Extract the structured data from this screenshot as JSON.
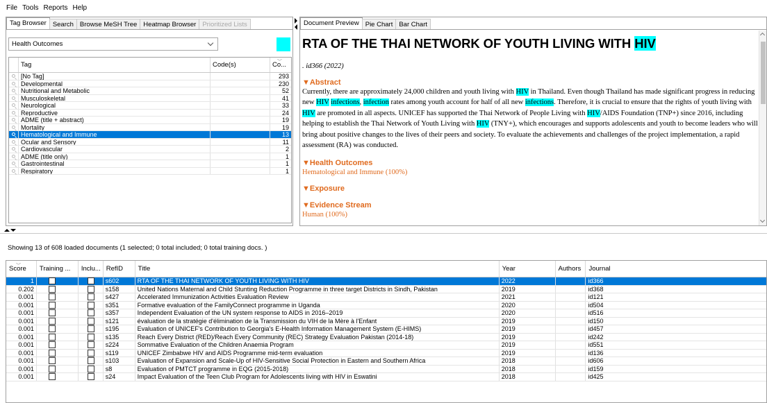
{
  "menu": [
    "File",
    "Tools",
    "Reports",
    "Help"
  ],
  "left_tabs": [
    {
      "label": "Tag Browser",
      "state": "active"
    },
    {
      "label": "Search",
      "state": "normal"
    },
    {
      "label": "Browse MeSH Tree",
      "state": "normal"
    },
    {
      "label": "Heatmap Browser",
      "state": "normal"
    },
    {
      "label": "Prioritized Lists",
      "state": "disabled"
    }
  ],
  "category_select": {
    "value": "Health Outcomes",
    "swatch_color": "#00ffff"
  },
  "tag_table": {
    "headers": [
      "Tag",
      "Code(s)",
      "Co..."
    ],
    "rows": [
      {
        "tag": "[No Tag]",
        "codes": "",
        "count": "293",
        "selected": false
      },
      {
        "tag": "Developmental",
        "codes": "",
        "count": "230",
        "selected": false
      },
      {
        "tag": "Nutritional and Metabolic",
        "codes": "",
        "count": "52",
        "selected": false
      },
      {
        "tag": "Musculoskeletal",
        "codes": "",
        "count": "41",
        "selected": false
      },
      {
        "tag": "Neurological",
        "codes": "",
        "count": "33",
        "selected": false
      },
      {
        "tag": "Reproductive",
        "codes": "",
        "count": "24",
        "selected": false
      },
      {
        "tag": "ADME (title + abstract)",
        "codes": "",
        "count": "19",
        "selected": false
      },
      {
        "tag": "Mortality",
        "codes": "",
        "count": "19",
        "selected": false
      },
      {
        "tag": "Hematological and Immune",
        "codes": "",
        "count": "13",
        "selected": true
      },
      {
        "tag": "Ocular and Sensory",
        "codes": "",
        "count": "11",
        "selected": false
      },
      {
        "tag": "Cardiovascular",
        "codes": "",
        "count": "2",
        "selected": false
      },
      {
        "tag": "ADME (title only)",
        "codes": "",
        "count": "1",
        "selected": false
      },
      {
        "tag": "Gastrointestinal",
        "codes": "",
        "count": "1",
        "selected": false
      },
      {
        "tag": "Respiratory",
        "codes": "",
        "count": "1",
        "selected": false
      }
    ]
  },
  "right_tabs": [
    {
      "label": "Document Preview",
      "state": "active"
    },
    {
      "label": "Pie Chart",
      "state": "normal"
    },
    {
      "label": "Bar Chart",
      "state": "normal"
    }
  ],
  "document": {
    "title_prefix": "RTA OF THE THAI NETWORK OF YOUTH LIVING WITH ",
    "title_highlight": "HIV",
    "meta": ". id366 (2022)",
    "abstract_heading": "▼Abstract",
    "abstract_parts": [
      {
        "text": "Currently, there are approximately 24,000 children and youth living with ",
        "hl": false
      },
      {
        "text": "HIV",
        "hl": true
      },
      {
        "text": " in Thailand. Even though Thailand has made significant progress in reducing new ",
        "hl": false
      },
      {
        "text": "HIV",
        "hl": true
      },
      {
        "text": " ",
        "hl": false
      },
      {
        "text": "infections",
        "hl": true
      },
      {
        "text": ", ",
        "hl": false
      },
      {
        "text": "infection",
        "hl": true
      },
      {
        "text": " rates among youth account for half of all new ",
        "hl": false
      },
      {
        "text": "infections",
        "hl": true
      },
      {
        "text": ". Therefore, it is crucial to ensure that the rights of youth living with ",
        "hl": false
      },
      {
        "text": "HIV",
        "hl": true
      },
      {
        "text": " are promoted in all aspects. UNICEF has supported the Thai Network of People Living with ",
        "hl": false
      },
      {
        "text": "HIV",
        "hl": true
      },
      {
        "text": "/AIDS Foundation (TNP+) since 2016, including helping to establish the Thai Network of Youth Living with ",
        "hl": false
      },
      {
        "text": "HIV",
        "hl": true
      },
      {
        "text": " (TNY+), which encourages and supports adolescents and youth to become leaders who will bring about positive changes to the lives of their peers and society. To evaluate the achievements and challenges of the project implementation, a rapid assessment (RA) was conducted.",
        "hl": false
      }
    ],
    "sections": [
      {
        "heading": "▼Health Outcomes",
        "value": "Hematological and Immune (100%)"
      },
      {
        "heading": "▼Exposure",
        "value": ""
      },
      {
        "heading": "▼Evidence Stream",
        "value": "Human (100%)"
      }
    ]
  },
  "status_line": "Showing 13 of 608 loaded documents (1 selected; 0 total included; 0 total training docs. )",
  "doc_table": {
    "headers": [
      "Score",
      "Training ...",
      "Inclu...",
      "RefID",
      "Title",
      "Year",
      "Authors",
      "Journal"
    ],
    "rows": [
      {
        "score": "1",
        "refid": "s602",
        "title": "RTA OF THE THAI NETWORK OF YOUTH LIVING WITH HIV",
        "year": "2022",
        "authors": "",
        "journal": "id366",
        "selected": true
      },
      {
        "score": "0.202",
        "refid": "s158",
        "title": "United Nations Maternal and Child Stunting Reduction Programme in three target Districts in Sindh, Pakistan",
        "year": "2019",
        "authors": "",
        "journal": "id368",
        "selected": false
      },
      {
        "score": "0.001",
        "refid": "s427",
        "title": "Accelerated Immunization Activities Evaluation Review",
        "year": "2021",
        "authors": "",
        "journal": "id121",
        "selected": false
      },
      {
        "score": "0.001",
        "refid": "s351",
        "title": "Formative evaluation of the FamilyConnect programme in Uganda",
        "year": "2020",
        "authors": "",
        "journal": "id504",
        "selected": false
      },
      {
        "score": "0.001",
        "refid": "s357",
        "title": "Independent Evaluation of the UN system response to AIDS in 2016–2019",
        "year": "2020",
        "authors": "",
        "journal": "id516",
        "selected": false
      },
      {
        "score": "0.001",
        "refid": "s121",
        "title": "évaluation de la stratégie d'élimination de la Transmission du VIH de la Mère à l'Enfant",
        "year": "2019",
        "authors": "",
        "journal": "id150",
        "selected": false
      },
      {
        "score": "0.001",
        "refid": "s195",
        "title": "Evaluation of UNICEF's Contribution to Georgia's E-Health Information Management System (E-HIMS)",
        "year": "2019",
        "authors": "",
        "journal": "id457",
        "selected": false
      },
      {
        "score": "0.001",
        "refid": "s135",
        "title": "Reach Every District (RED)/Reach Every Community (REC) Strategy Evaluation Pakistan (2014-18)",
        "year": "2019",
        "authors": "",
        "journal": "id242",
        "selected": false
      },
      {
        "score": "0.001",
        "refid": "s224",
        "title": "Sommative Evaluation of the Children Anaemia Program",
        "year": "2019",
        "authors": "",
        "journal": "id551",
        "selected": false
      },
      {
        "score": "0.001",
        "refid": "s119",
        "title": "UNICEF Zimbabwe HIV and AIDS Programme mid-term evaluation",
        "year": "2019",
        "authors": "",
        "journal": "id136",
        "selected": false
      },
      {
        "score": "0.001",
        "refid": "s103",
        "title": "Evaluation of Expansion and Scale-Up of HIV-Sensitive Social Protection in Eastern and Southern Africa",
        "year": "2018",
        "authors": "",
        "journal": "id606",
        "selected": false
      },
      {
        "score": "0.001",
        "refid": "s8",
        "title": "Evaluation of PMTCT programme in EQG (2015-2018)",
        "year": "2018",
        "authors": "",
        "journal": "id159",
        "selected": false
      },
      {
        "score": "0.001",
        "refid": "s24",
        "title": "Impact Evaluation of the Teen Club Program for Adolescents living with HIV in Eswatini",
        "year": "2018",
        "authors": "",
        "journal": "id425",
        "selected": false
      }
    ]
  }
}
